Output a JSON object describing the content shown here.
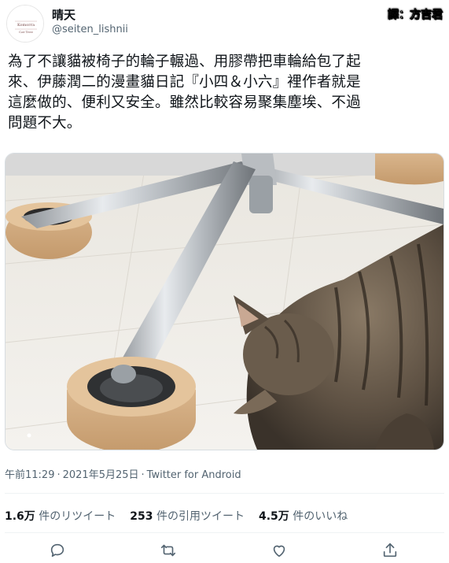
{
  "author": {
    "display_name": "晴天",
    "handle": "@seiten_lishnii",
    "avatar_text_1": "Komorra",
    "avatar_text_2": "Cat Tree"
  },
  "translator_credit": "譯：方吉君",
  "tweet": {
    "text_lines": [
      "為了不讓貓被椅子的輪子輾過、用膠帶把車輪給包了起",
      "來、伊藤潤二的漫畫貓日記『小四＆小六』裡作者就是",
      "這麼做的、便利又安全。雖然比較容易聚集塵埃、不過",
      "問題不大。"
    ]
  },
  "photo": {
    "subject_icon": "cat-photo"
  },
  "meta": {
    "time": "午前11:29",
    "date": "2021年5月25日",
    "source": "Twitter for Android"
  },
  "stats": {
    "retweets_count": "1.6万",
    "retweets_label": "件のリツイート",
    "quotes_count": "253",
    "quotes_label": "件の引用ツイート",
    "likes_count": "4.5万",
    "likes_label": "件のいいね"
  },
  "actions": {
    "reply_icon": "reply-icon",
    "retweet_icon": "retweet-icon",
    "like_icon": "heart-icon",
    "share_icon": "share-icon"
  },
  "colors": {
    "text_primary": "#0f1419",
    "text_secondary": "#536471",
    "divider": "#eff3f4",
    "tape": "#d7b48a"
  }
}
